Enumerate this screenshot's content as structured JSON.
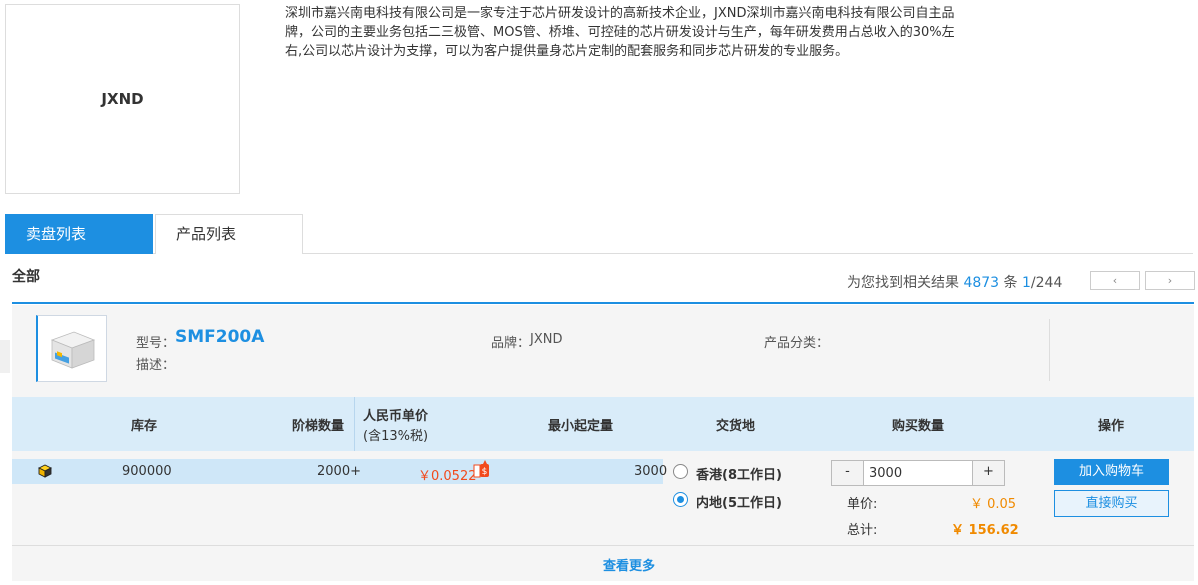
{
  "brand": {
    "logo_text": "JXND",
    "description": "深圳市嘉兴南电科技有限公司是一家专注于芯片研发设计的高新技术企业，JXND深圳市嘉兴南电科技有限公司自主品牌，公司的主要业务包括二三极管、MOS管、桥堆、可控硅的芯片研发设计与生产，每年研发费用占总收入的30%左右,公司以芯片设计为支撑，可以为客户提供量身芯片定制的配套服务和同步芯片研发的专业服务。"
  },
  "tabs": [
    {
      "label": "卖盘列表",
      "active": true
    },
    {
      "label": "产品列表",
      "active": false
    }
  ],
  "filter": {
    "all_label": "全部"
  },
  "results": {
    "prefix": "为您找到相关结果",
    "count": "4873",
    "unit": "条",
    "page": "1",
    "total_pages": "/244",
    "prev_label": "‹",
    "next_label": "›"
  },
  "product": {
    "model_label": "型号：",
    "model": "SMF200A",
    "desc_label": "描述：",
    "brand_label": "品牌：",
    "brand": "JXND",
    "category_label": "产品分类：",
    "table_headers": {
      "stock": "库存",
      "tier_qty": "阶梯数量",
      "price_line1": "人民币单价",
      "price_line2": "(含13%税)",
      "moq": "最小起定量",
      "delivery": "交货地",
      "buy_qty": "购买数量",
      "action": "操作"
    },
    "row": {
      "stock": "900000",
      "tier_qty": "2000+",
      "price": "￥0.0522",
      "moq": "3000"
    },
    "delivery_options": [
      {
        "label": "香港(8工作日)",
        "checked": false
      },
      {
        "label": "内地(5工作日)",
        "checked": true
      }
    ],
    "qty": {
      "minus": "-",
      "value": "3000",
      "plus": "+"
    },
    "unit_price_label": "单价:",
    "unit_price": "￥ 0.05",
    "total_label": "总计:",
    "total": "￥ 156.62",
    "add_cart_label": "加入购物车",
    "buy_now_label": "直接购买",
    "more_label": "查看更多"
  },
  "colors": {
    "accent": "#1d8fe1",
    "price": "#f24a1d",
    "total": "#f08a00"
  }
}
